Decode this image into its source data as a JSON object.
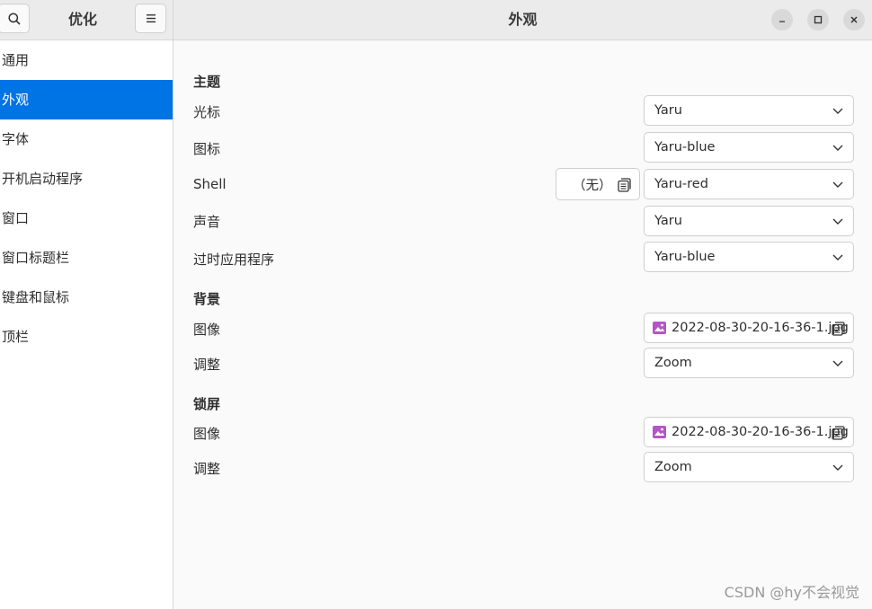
{
  "header": {
    "sidebar_title": "优化",
    "main_title": "外观"
  },
  "sidebar": {
    "items": [
      {
        "label": "通用"
      },
      {
        "label": "外观"
      },
      {
        "label": "字体"
      },
      {
        "label": "开机启动程序"
      },
      {
        "label": "窗口"
      },
      {
        "label": "窗口标题栏"
      },
      {
        "label": "键盘和鼠标"
      },
      {
        "label": "顶栏"
      }
    ],
    "active_index": 1
  },
  "theme": {
    "section": "主题",
    "cursor_label": "光标",
    "cursor_value": "Yaru",
    "icons_label": "图标",
    "icons_value": "Yaru-blue",
    "shell_label": "Shell",
    "shell_none": "（无）",
    "shell_value": "Yaru-red",
    "sound_label": "声音",
    "sound_value": "Yaru",
    "legacy_label": "过时应用程序",
    "legacy_value": "Yaru-blue"
  },
  "background": {
    "section": "背景",
    "image_label": "图像",
    "image_value": "2022-08-30-20-16-36-1.jpg",
    "adjust_label": "调整",
    "adjust_value": "Zoom"
  },
  "lockscreen": {
    "section": "锁屏",
    "image_label": "图像",
    "image_value": "2022-08-30-20-16-36-1.jpg",
    "adjust_label": "调整",
    "adjust_value": "Zoom"
  },
  "watermark": "CSDN @hy不会视觉",
  "colors": {
    "accent": "#0073e5",
    "image_icon": "#b455c8"
  }
}
